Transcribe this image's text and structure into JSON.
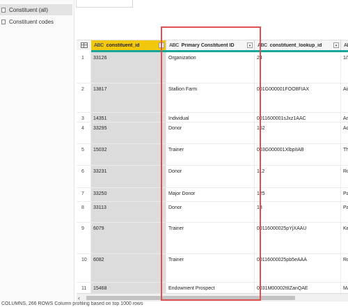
{
  "queries": {
    "items": [
      {
        "label": "Constituent (all)",
        "selected": true
      },
      {
        "label": "Constituent codes",
        "selected": false
      }
    ]
  },
  "grid": {
    "columns": [
      {
        "type": "ABC",
        "name": "constituent_id",
        "highlighted": true
      },
      {
        "type": "ABC",
        "name": "Primary Constituent ID",
        "highlighted": false
      },
      {
        "type": "ABC",
        "name": "constituent_lookup_id",
        "highlighted": false
      }
    ],
    "rows": [
      {
        "n": "1",
        "id": "33126",
        "primary": "Organization",
        "lookup": "24",
        "c4": "1/S"
      },
      {
        "n": "2",
        "id": "13817",
        "primary": "Stallion Farm",
        "lookup": "001G000001FOO8FIAX",
        "c4": "Ain"
      },
      {
        "n": "3",
        "id": "14351",
        "primary": "Individual",
        "lookup": "0011600001sJxz1AAC",
        "c4": "An"
      },
      {
        "n": "4",
        "id": "33295",
        "primary": "Donor",
        "lookup": "162",
        "c4": "Ad"
      },
      {
        "n": "5",
        "id": "15032",
        "primary": "Trainer",
        "lookup": "003G000001XlbpIIAB",
        "c4": "The"
      },
      {
        "n": "6",
        "id": "33231",
        "primary": "Donor",
        "lookup": "112",
        "c4": "Ro"
      },
      {
        "n": "7",
        "id": "33250",
        "primary": "Major Donor",
        "lookup": "125",
        "c4": "Pa"
      },
      {
        "n": "8",
        "id": "33113",
        "primary": "Donor",
        "lookup": "13",
        "c4": "Pa"
      },
      {
        "n": "9",
        "id": "6079",
        "primary": "Trainer",
        "lookup": "00116000025pYjXAAU",
        "c4": "Ke"
      },
      {
        "n": "10",
        "id": "6082",
        "primary": "Trainer",
        "lookup": "00116000025pb5eAAA",
        "c4": "Ro"
      },
      {
        "n": "11",
        "id": "15468",
        "primary": "Endowment Prospect",
        "lookup": "0031M00002t8ZanQAE",
        "c4": "Ma"
      }
    ]
  },
  "status": "COLUMNS, 266 ROWS     Column profiling based on top 1000 rows",
  "colors": {
    "selected_header": "#f2c80f",
    "quality_bar": "#15a89a",
    "annotation_box": "#e05050"
  }
}
